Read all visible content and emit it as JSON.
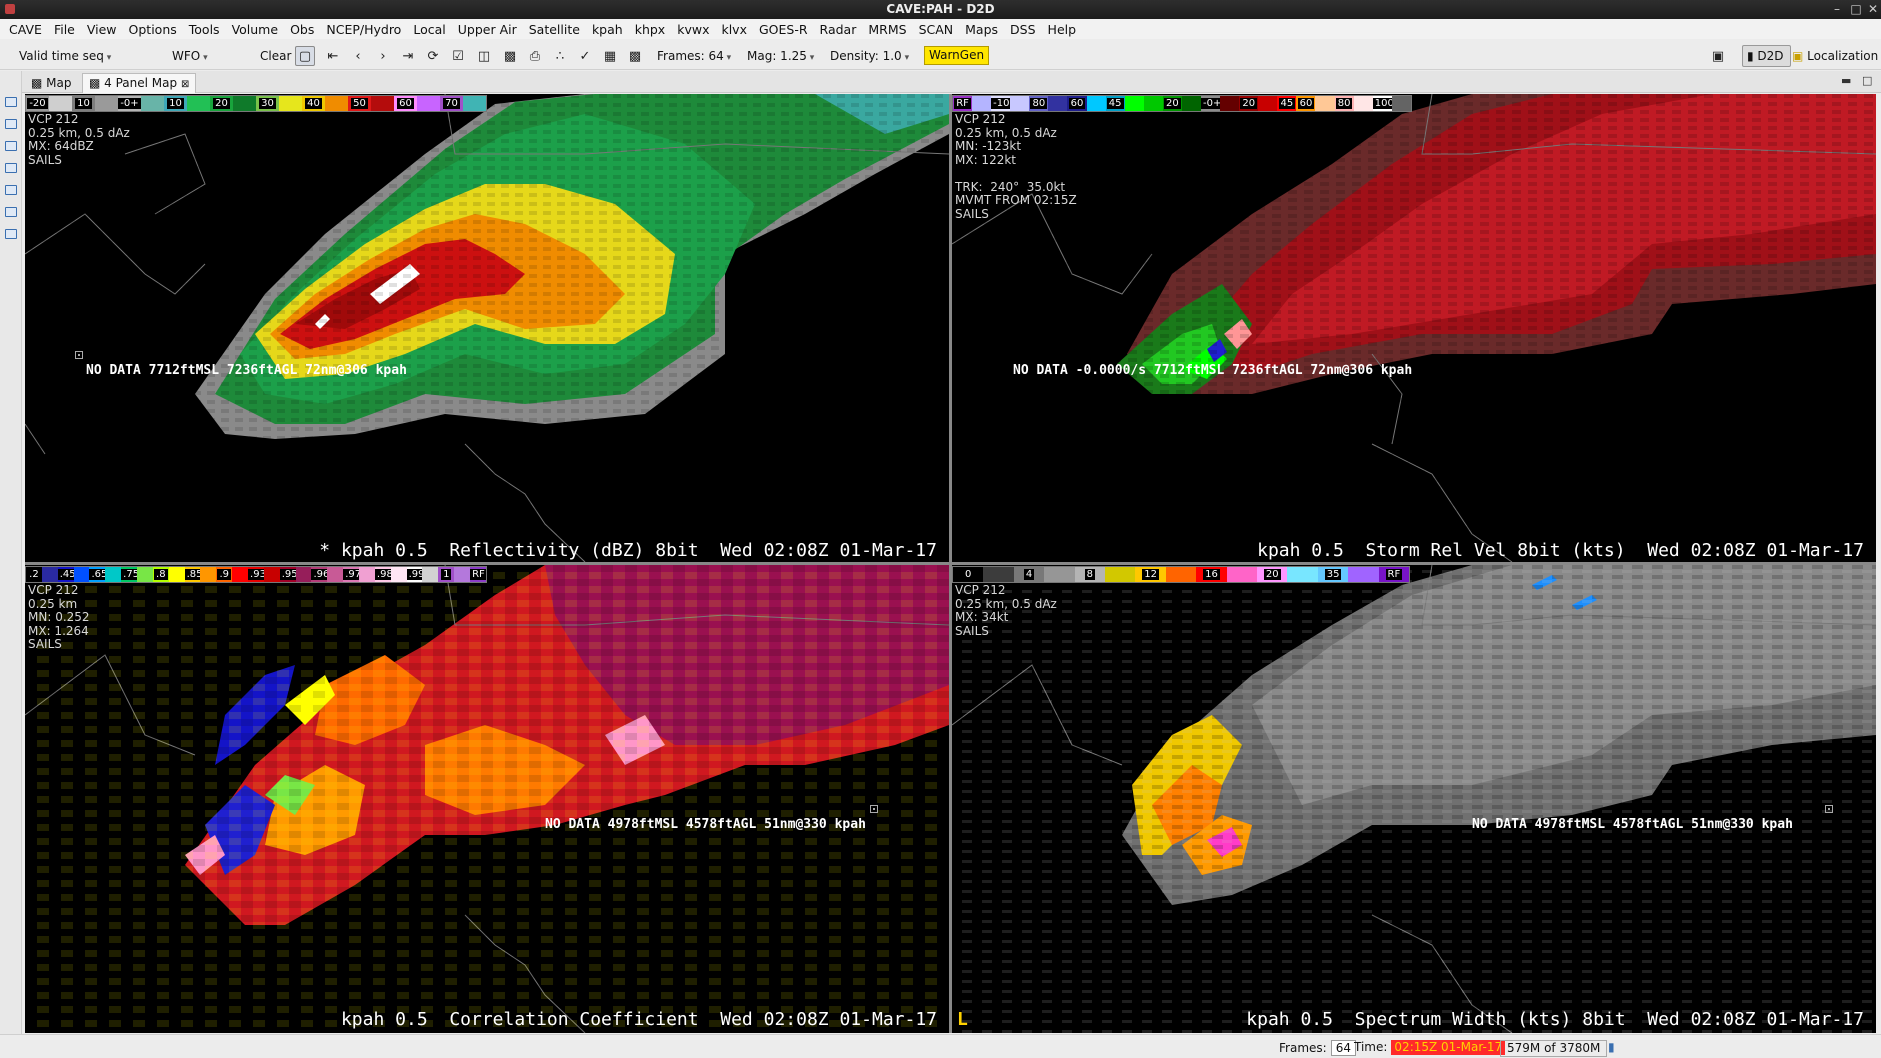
{
  "window": {
    "title": "CAVE:PAH - D2D"
  },
  "menu": [
    "CAVE",
    "File",
    "View",
    "Options",
    "Tools",
    "Volume",
    "Obs",
    "NCEP/Hydro",
    "Local",
    "Upper Air",
    "Satellite",
    "kpah",
    "khpx",
    "kvwx",
    "klvx",
    "GOES-R",
    "Radar",
    "MRMS",
    "SCAN",
    "Maps",
    "DSS",
    "Help"
  ],
  "toolbar": {
    "loop_mode": "Valid time seq",
    "wfo": "WFO",
    "clear": "Clear",
    "frames": "Frames: 64",
    "mag": "Mag: 1.25",
    "density": "Density: 1.0",
    "warngen": "WarnGen",
    "perspective": "D2D",
    "localization": "Localization"
  },
  "tabs": [
    {
      "label": "Map"
    },
    {
      "label": "4 Panel Map"
    }
  ],
  "colors": {
    "warngen_bg": "#ffe600",
    "time_bg": "#ff2a2a",
    "time_fg": "#ffd200"
  },
  "panels": {
    "reflectivity": {
      "info": [
        "VCP 212",
        "0.25 km, 0.5 dAz",
        "MX: 64dBZ",
        "SAILS"
      ],
      "sample": "NO DATA 7712ftMSL 7236ftAGL 72nm@306 kpah",
      "label": "* kpah 0.5  Reflectivity (dBZ) 8bit  Wed 02:08Z 01-Mar-17",
      "colorbar": [
        {
          "t": "-20",
          "c": "#9a9a9a"
        },
        {
          "t": "",
          "c": "#cfcfcf"
        },
        {
          "t": "10",
          "c": "#7e7e7e"
        },
        {
          "t": "",
          "c": "#9a9a9a"
        },
        {
          "t": "-0+",
          "c": "#b4b4b4"
        },
        {
          "t": "",
          "c": "#68b4a8"
        },
        {
          "t": "10",
          "c": "#3fa8b8"
        },
        {
          "t": "",
          "c": "#22c055"
        },
        {
          "t": "20",
          "c": "#18a43c"
        },
        {
          "t": "",
          "c": "#0f7a2a"
        },
        {
          "t": "30",
          "c": "#7ac24a"
        },
        {
          "t": "",
          "c": "#e6e61c"
        },
        {
          "t": "40",
          "c": "#f0c800"
        },
        {
          "t": "",
          "c": "#f08c00"
        },
        {
          "t": "50",
          "c": "#e01818"
        },
        {
          "t": "",
          "c": "#b40c0c"
        },
        {
          "t": "60",
          "c": "#ff8cff"
        },
        {
          "t": "",
          "c": "#c864ff"
        },
        {
          "t": "70",
          "c": "#a050c8"
        },
        {
          "t": "",
          "c": "#40b4b4"
        }
      ]
    },
    "velocity": {
      "info": [
        "VCP 212",
        "0.25 km, 0.5 dAz",
        "MN: -123kt",
        "MX: 122kt",
        "",
        "TRK:  240°  35.0kt",
        "MVMT FROM 02:15Z",
        "SAILS"
      ],
      "sample": "NO DATA -0.0000/s 7712ftMSL 7236ftAGL 72nm@306 kpah",
      "label": "kpah 0.5  Storm Rel Vel 8bit (kts)  Wed 02:08Z 01-Mar-17",
      "colorbar": [
        {
          "t": "RF",
          "c": "#9a32c8"
        },
        {
          "t": "",
          "c": "#b4b4ff"
        },
        {
          "t": "-100",
          "c": "#e0e0ff"
        },
        {
          "t": "",
          "c": "#c8c8ff"
        },
        {
          "t": "80",
          "c": "#6464c8"
        },
        {
          "t": "",
          "c": "#3232a0"
        },
        {
          "t": "60",
          "c": "#1e1e8c"
        },
        {
          "t": "",
          "c": "#00c8ff"
        },
        {
          "t": "45",
          "c": "#00a0c8"
        },
        {
          "t": "",
          "c": "#00ff00"
        },
        {
          "t": "",
          "c": "#00c800"
        },
        {
          "t": "20",
          "c": "#009600"
        },
        {
          "t": "",
          "c": "#006400"
        },
        {
          "t": "-0+",
          "c": "#8c8c8c"
        },
        {
          "t": "",
          "c": "#640000"
        },
        {
          "t": "20",
          "c": "#960000"
        },
        {
          "t": "",
          "c": "#c80000"
        },
        {
          "t": "45",
          "c": "#ff0000"
        },
        {
          "t": "60",
          "c": "#ff9600"
        },
        {
          "t": "",
          "c": "#ffc896"
        },
        {
          "t": "80",
          "c": "#ffb4b4"
        },
        {
          "t": "",
          "c": "#ffe6e6"
        },
        {
          "t": "100",
          "c": "#ffffff"
        },
        {
          "t": "",
          "c": "#646464"
        }
      ]
    },
    "correlation": {
      "info": [
        "VCP 212",
        "0.25 km",
        "MN: 0.252",
        "MX: 1.264",
        "SAILS"
      ],
      "sample": "NO DATA 4978ftMSL 4578ftAGL 51nm@330 kpah",
      "label": "kpah 0.5  Correlation Coefficient  Wed 02:08Z 01-Mar-17",
      "colorbar": [
        {
          "t": ".2",
          "c": "#000000"
        },
        {
          "t": "",
          "c": "#2a2aa0"
        },
        {
          "t": ".45",
          "c": "#1414c8"
        },
        {
          "t": "",
          "c": "#0050ff"
        },
        {
          "t": ".65",
          "c": "#00a0ff"
        },
        {
          "t": "",
          "c": "#00c8c8"
        },
        {
          "t": ".75",
          "c": "#00c864"
        },
        {
          "t": "",
          "c": "#78e646"
        },
        {
          "t": ".8",
          "c": "#b4ff00"
        },
        {
          "t": "",
          "c": "#ffff00"
        },
        {
          "t": ".85",
          "c": "#ffc800"
        },
        {
          "t": "",
          "c": "#ff9600"
        },
        {
          "t": ".9",
          "c": "#ff6400"
        },
        {
          "t": "",
          "c": "#ff0000"
        },
        {
          "t": ".93",
          "c": "#e60000"
        },
        {
          "t": "",
          "c": "#c80000"
        },
        {
          "t": ".95",
          "c": "#a00028"
        },
        {
          "t": "",
          "c": "#961e5a"
        },
        {
          "t": ".96",
          "c": "#b43c78"
        },
        {
          "t": "",
          "c": "#c85a96"
        },
        {
          "t": ".97",
          "c": "#dc78b4"
        },
        {
          "t": "",
          "c": "#f0a0d2"
        },
        {
          "t": ".98",
          "c": "#ffc8e6"
        },
        {
          "t": "",
          "c": "#ffe6f5"
        },
        {
          "t": ".99",
          "c": "#ffffff"
        },
        {
          "t": "",
          "c": "#d2d2d2"
        },
        {
          "t": "1",
          "c": "#a050c8"
        },
        {
          "t": "",
          "c": "#b478dc"
        },
        {
          "t": "RF",
          "c": "#8c3cc8"
        }
      ]
    },
    "spectrum": {
      "info": [
        "VCP 212",
        "0.25 km, 0.5 dAz",
        "MX: 34kt",
        "SAILS"
      ],
      "sample": "NO DATA 4978ftMSL 4578ftAGL 51nm@330 kpah",
      "label": "kpah 0.5  Spectrum Width (kts) 8bit  Wed 02:08Z 01-Mar-17",
      "legend_letter": "L",
      "colorbar": [
        {
          "t": "0",
          "c": "#000000"
        },
        {
          "t": "",
          "c": "#3c3c3c"
        },
        {
          "t": "4",
          "c": "#787878"
        },
        {
          "t": "",
          "c": "#969696"
        },
        {
          "t": "8",
          "c": "#b4b4b4"
        },
        {
          "t": "",
          "c": "#d2c800"
        },
        {
          "t": "12",
          "c": "#ffc800"
        },
        {
          "t": "",
          "c": "#ff6400"
        },
        {
          "t": "16",
          "c": "#ff0000"
        },
        {
          "t": "",
          "c": "#ff64c8"
        },
        {
          "t": "20",
          "c": "#ff96ff"
        },
        {
          "t": "",
          "c": "#78e6ff"
        },
        {
          "t": "35",
          "c": "#64c8ff"
        },
        {
          "t": "",
          "c": "#a064ff"
        },
        {
          "t": "RF",
          "c": "#7814c8"
        }
      ]
    }
  },
  "status": {
    "frames_label": "Frames:",
    "frames_value": "64",
    "time_label": "Time:",
    "time_value": "02:15Z 01-Mar-17",
    "memory": "579M of 3780M"
  }
}
